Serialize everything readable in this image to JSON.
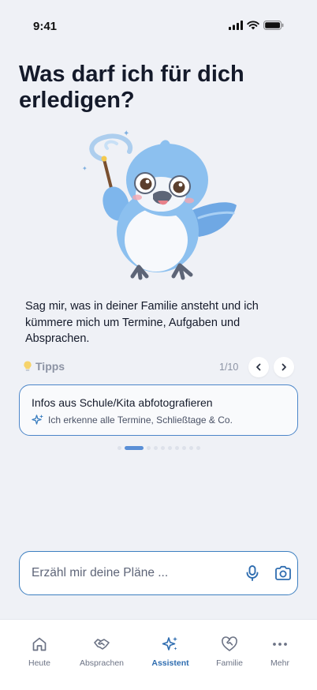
{
  "status_bar": {
    "time": "9:41",
    "icons": [
      "cellular-signal-icon",
      "wifi-icon",
      "battery-icon"
    ]
  },
  "headline": "Was darf ich für dich erledigen?",
  "intro": "Sag mir, was in deiner Familie ansteht und ich kümmere mich um Termine, Aufgaben und Absprachen.",
  "tips": {
    "icon": "lightbulb-icon",
    "label": "Tipps",
    "counter": "1/10",
    "prev_icon": "chevron-left-icon",
    "next_icon": "chevron-right-icon",
    "card": {
      "title": "Infos aus Schule/Kita abfotografieren",
      "subtitle_icon": "sparkle-icon",
      "subtitle": "Ich erkenne alle Termine, Schließtage & Co."
    },
    "pagination": {
      "total": 10,
      "active": 1
    }
  },
  "composer": {
    "placeholder": "Erzähl mir deine Pläne ...",
    "value": "",
    "mic_icon": "microphone-icon",
    "camera_icon": "camera-icon"
  },
  "tabbar": {
    "items": [
      {
        "label": "Heute",
        "icon": "home-icon",
        "active": false
      },
      {
        "label": "Absprachen",
        "icon": "handshake-icon",
        "active": false
      },
      {
        "label": "Assistent",
        "icon": "sparkles-icon",
        "active": true
      },
      {
        "label": "Familie",
        "icon": "heart-handshake-icon",
        "active": false
      },
      {
        "label": "Mehr",
        "icon": "more-horizontal-icon",
        "active": false
      }
    ]
  },
  "colors": {
    "background": "#eff1f6",
    "accent": "#2f6db0",
    "card_border": "#4c86c9",
    "pagination_active": "#5a8fd6"
  }
}
